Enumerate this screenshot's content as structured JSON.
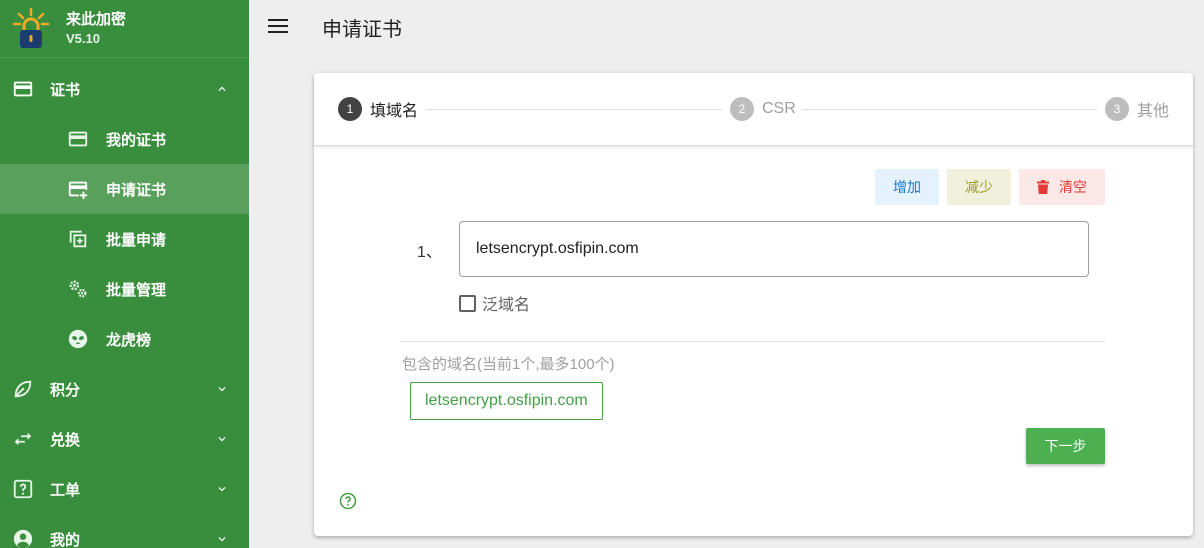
{
  "app": {
    "name": "来此加密",
    "version": "V5.10"
  },
  "sidebar": {
    "cert_group": {
      "label": "证书"
    },
    "cert_items": [
      {
        "label": "我的证书",
        "icon": "credit-card-icon"
      },
      {
        "label": "申请证书",
        "icon": "card-plus-icon",
        "active": true
      },
      {
        "label": "批量申请",
        "icon": "copy-plus-icon"
      },
      {
        "label": "批量管理",
        "icon": "cogs-icon"
      },
      {
        "label": "龙虎榜",
        "icon": "alien-icon"
      }
    ],
    "groups": [
      {
        "label": "积分",
        "icon": "leaf-icon"
      },
      {
        "label": "兑换",
        "icon": "swap-icon"
      },
      {
        "label": "工单",
        "icon": "help-box-icon"
      },
      {
        "label": "我的",
        "icon": "account-circle-icon"
      }
    ]
  },
  "header": {
    "title": "申请证书"
  },
  "stepper": {
    "steps": [
      {
        "num": "1",
        "label": "填域名"
      },
      {
        "num": "2",
        "label": "CSR"
      },
      {
        "num": "3",
        "label": "其他"
      }
    ]
  },
  "actions": {
    "add": "增加",
    "remove": "减少",
    "clear": "清空"
  },
  "form": {
    "row_index": "1、",
    "domain_value": "letsencrypt.osfipin.com",
    "wildcard_label": "泛域名",
    "included_label": "包含的域名(当前1个,最多100个)",
    "included_domains": [
      "letsencrypt.osfipin.com"
    ],
    "next_label": "下一步"
  },
  "colors": {
    "sidebar": "#388e3c",
    "accent": "#4caf50",
    "danger": "#e53935"
  }
}
